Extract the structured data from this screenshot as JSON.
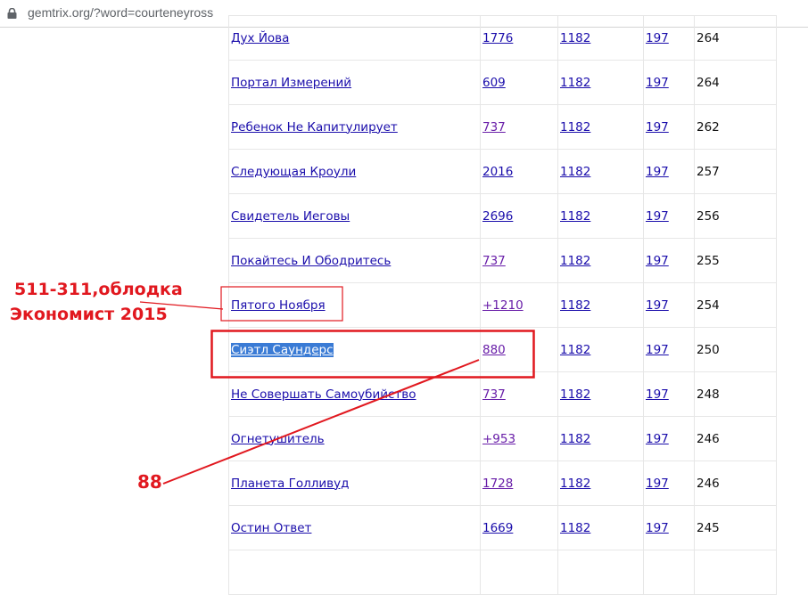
{
  "browser": {
    "url": "gemtrix.org/?word=courteneyross",
    "lock_icon": "lock-icon"
  },
  "results": [
    {
      "phrase": "Дух Йова",
      "v1": "1776",
      "v1_visited": false,
      "v2": "1182",
      "v3": "197",
      "v4": "264"
    },
    {
      "phrase": "Портал Измерений",
      "v1": "609",
      "v1_visited": false,
      "v2": "1182",
      "v3": "197",
      "v4": "264"
    },
    {
      "phrase": "Ребенок Не Капитулирует",
      "v1": "737",
      "v1_visited": true,
      "v2": "1182",
      "v3": "197",
      "v4": "262"
    },
    {
      "phrase": "Следующая Кроули",
      "v1": "2016",
      "v1_visited": false,
      "v2": "1182",
      "v3": "197",
      "v4": "257"
    },
    {
      "phrase": "Свидетель Иеговы",
      "v1": "2696",
      "v1_visited": false,
      "v2": "1182",
      "v3": "197",
      "v4": "256"
    },
    {
      "phrase": "Покайтесь И Ободритесь",
      "v1": "737",
      "v1_visited": true,
      "v2": "1182",
      "v3": "197",
      "v4": "255"
    },
    {
      "phrase": "Пятого Ноября",
      "v1": "+1210",
      "v1_visited": true,
      "v2": "1182",
      "v3": "197",
      "v4": "254"
    },
    {
      "phrase": "Сиэтл Саундерс",
      "v1": "880",
      "v1_visited": true,
      "v2": "1182",
      "v3": "197",
      "v4": "250"
    },
    {
      "phrase": "Не Совершать Самоубийство",
      "v1": "737",
      "v1_visited": true,
      "v2": "1182",
      "v3": "197",
      "v4": "248"
    },
    {
      "phrase": "Огнетушитель",
      "v1": "+953",
      "v1_visited": true,
      "v2": "1182",
      "v3": "197",
      "v4": "246"
    },
    {
      "phrase": "Планета Голливуд",
      "v1": "1728",
      "v1_visited": true,
      "v2": "1182",
      "v3": "197",
      "v4": "246"
    },
    {
      "phrase": "Остин Ответ",
      "v1": "1669",
      "v1_visited": false,
      "v2": "1182",
      "v3": "197",
      "v4": "245"
    },
    {
      "phrase": "",
      "v1": "",
      "v1_visited": false,
      "v2": "",
      "v3": "",
      "v4": ""
    }
  ],
  "annotations": {
    "note_line1": "511-311,облодка",
    "note_line2": "Экономист 2015",
    "note_88": "88",
    "color": "#e1181f"
  },
  "colors": {
    "link": "#1a0dab",
    "visited_link": "#681da8",
    "selection": "#3a7bd5",
    "annotation_red": "#e1181f"
  }
}
